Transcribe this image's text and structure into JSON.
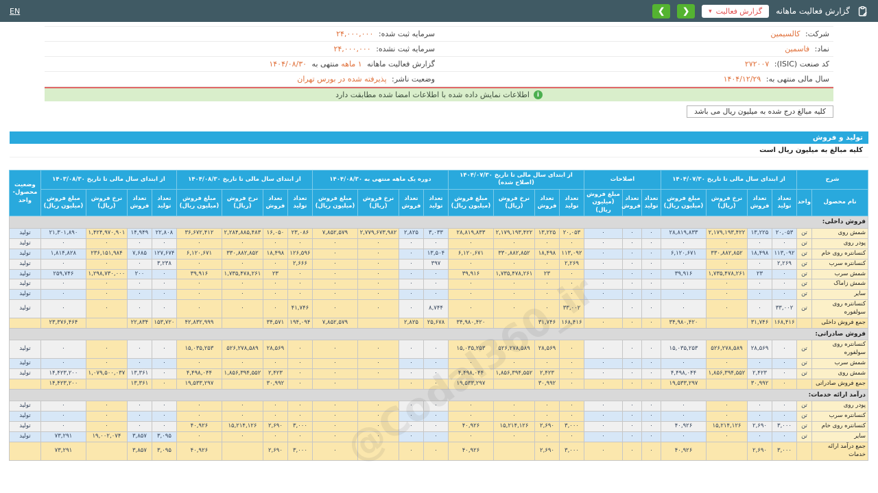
{
  "topbar": {
    "en": "EN",
    "title": "گزارش فعالیت ماهانه",
    "dropdown_label": "گزارش فعالیت",
    "caret": "▾",
    "nav_right": "❯",
    "nav_left": "❮"
  },
  "info": {
    "right": [
      {
        "label": "شرکت:",
        "value": "کالسیمین"
      },
      {
        "label": "نماد:",
        "value": "فاسمین"
      },
      {
        "label": "کد صنعت (ISIC):",
        "value": "۲۷۲۰۰۷"
      },
      {
        "label": "سال مالی منتهی به:",
        "value": "۱۴۰۴/۱۲/۲۹"
      }
    ],
    "left": [
      {
        "label": "سرمایه ثبت شده:",
        "value": "۲۴,۰۰۰,۰۰۰"
      },
      {
        "label": "سرمایه ثبت نشده:",
        "value": "۲۴,۰۰۰,۰۰۰"
      },
      {
        "label": "گزارش فعالیت ماهانه",
        "value": "۱ ماهه",
        "mid": "منتهی به",
        "value2": "۱۴۰۴/۰۸/۳۰"
      },
      {
        "label": "وضعیت ناشر:",
        "value": "پذیرفته شده در بورس تهران"
      }
    ]
  },
  "banner": "اطلاعات نمایش داده شده با اطلاعات امضا شده مطابقت دارد",
  "amount_note": "کلیه مبالغ درج شده به میلیون ریال می باشد",
  "watermark": "@Codal360_ir",
  "colors": {
    "topbar": "#405a64",
    "accent_blue": "#29a9dd",
    "nav_green": "#54b331",
    "value_orange": "#e0703a",
    "cell_yellow": "#fbe7ad",
    "stripe_blue": "#d7e7f7",
    "banner_green": "#d9eecb",
    "red_line": "#e06666"
  },
  "table": {
    "title": "تولید و فروش",
    "note": "کلیه مبالغ به میلیون ریال است",
    "header": {
      "desc": "شرح",
      "product": "نام محصول",
      "unit": "واحد",
      "status": "وضعیت محصول-واحد",
      "sub4": [
        "تعداد تولید",
        "تعداد فروش",
        "نرخ فروش (ریال)",
        "مبلغ فروش (میلیون ریال)"
      ],
      "sub3": [
        "تعداد تولید",
        "تعداد فروش",
        "مبلغ فروش (میلیون ریال)"
      ],
      "groups": [
        {
          "label": "از ابتدای سال مالی تا تاریخ ۱۴۰۴/۰۷/۳۰",
          "cols": 4
        },
        {
          "label": "اصلاحات",
          "cols": 3
        },
        {
          "label": "از ابتدای سال مالی تا تاریخ ۱۴۰۴/۰۷/۳۰ (اصلاح شده)",
          "cols": 4
        },
        {
          "label": "دوره یک ماهه منتهی به ۱۴۰۴/۰۸/۳۰",
          "cols": 4
        },
        {
          "label": "از ابتدای سال مالی تا تاریخ ۱۴۰۴/۰۸/۳۰",
          "cols": 4
        },
        {
          "label": "از ابتدای سال مالی تا تاریخ ۱۴۰۳/۰۸/۳۰",
          "cols": 4
        }
      ]
    },
    "sections": [
      {
        "title": "فروش داخلی:",
        "rows": [
          {
            "name": "شمش روی",
            "unit": "تن",
            "status": "تولید",
            "stripe": "b",
            "prev": [
              "۲۰,۰۵۳",
              "۱۳,۲۲۵",
              "۲,۱۷۹,۱۹۳,۴۲۲",
              "۲۸,۸۱۹,۸۳۳"
            ],
            "adj": [
              "۰",
              "۰",
              "۰"
            ],
            "prev_adj": [
              "۲۰,۰۵۳",
              "۱۳,۲۲۵",
              "۲,۱۷۹,۱۹۳,۴۲۲",
              "۲۸,۸۱۹,۸۳۳"
            ],
            "month": [
              "۳,۰۳۳",
              "۲,۸۲۵",
              "۲,۷۷۹,۶۷۳,۹۸۲",
              "۷,۸۵۲,۵۷۹"
            ],
            "ytd": [
              "۲۳,۰۸۶",
              "۱۶,۰۵۰",
              "۲,۲۸۴,۸۸۵,۴۸۳",
              "۳۶,۶۷۲,۴۱۲"
            ],
            "last": [
              "۲۲,۸۰۸",
              "۱۴,۹۴۹",
              "۱,۴۲۴,۹۷۰,۹۰۱",
              "۲۱,۳۰۱,۸۹۰"
            ]
          },
          {
            "name": "پودر روی",
            "unit": "تن",
            "status": "تولید",
            "stripe": "w",
            "prev": [
              "۰",
              "۰",
              "۰",
              "۰"
            ],
            "adj": [
              "۰",
              "۰",
              "۰"
            ],
            "prev_adj": [
              "۰",
              "۰",
              "۰",
              "۰"
            ],
            "month": [
              "۰",
              "۰",
              "۰",
              "۰"
            ],
            "ytd": [
              "۰",
              "۰",
              "۰",
              "۰"
            ],
            "last": [
              "۰",
              "۰",
              "۰",
              "۰"
            ]
          },
          {
            "name": "کنسانتره روی خام",
            "unit": "تن",
            "status": "تولید",
            "stripe": "b",
            "prev": [
              "۱۱۳,۰۹۲",
              "۱۸,۴۹۸",
              "۳۳۰,۸۸۲,۸۵۲",
              "۶,۱۲۰,۶۷۱"
            ],
            "adj": [
              "۰",
              "۰",
              "۰"
            ],
            "prev_adj": [
              "۱۱۳,۰۹۲",
              "۱۸,۴۹۸",
              "۳۳۰,۸۸۲,۸۵۲",
              "۶,۱۲۰,۶۷۱"
            ],
            "month": [
              "۱۳,۵۰۴",
              "۰",
              "۰",
              "۰"
            ],
            "ytd": [
              "۱۲۶,۵۹۶",
              "۱۸,۴۹۸",
              "۳۳۰,۸۸۲,۸۵۲",
              "۶,۱۲۰,۶۷۱"
            ],
            "last": [
              "۱۲۷,۶۷۴",
              "۷,۶۸۵",
              "۲۳۶,۱۵۱,۹۸۴",
              "۱,۸۱۴,۸۲۸"
            ]
          },
          {
            "name": "کنسانتره سرب",
            "unit": "تن",
            "status": "تولید",
            "stripe": "w",
            "prev": [
              "۲,۲۶۹",
              "۰",
              "۰",
              "۰"
            ],
            "adj": [
              "۰",
              "۰",
              "۰"
            ],
            "prev_adj": [
              "۲,۲۶۹",
              "۰",
              "۰",
              "۰"
            ],
            "month": [
              "۳۹۷",
              "۰",
              "۰",
              "۰"
            ],
            "ytd": [
              "۲,۶۶۶",
              "۰",
              "۰",
              "۰"
            ],
            "last": [
              "۳,۲۳۸",
              "۰",
              "۰",
              "۰"
            ]
          },
          {
            "name": "شمش سرب",
            "unit": "تن",
            "status": "تولید",
            "stripe": "b",
            "prev": [
              "۰",
              "۲۳",
              "۱,۷۳۵,۴۷۸,۲۶۱",
              "۳۹,۹۱۶"
            ],
            "adj": [
              "۰",
              "۰",
              "۰"
            ],
            "prev_adj": [
              "۰",
              "۲۳",
              "۱,۷۳۵,۴۷۸,۲۶۱",
              "۳۹,۹۱۶"
            ],
            "month": [
              "۰",
              "۰",
              "۰",
              "۰"
            ],
            "ytd": [
              "۰",
              "۲۳",
              "۱,۷۳۵,۴۷۸,۲۶۱",
              "۳۹,۹۱۶"
            ],
            "last": [
              "۰",
              "۲۰۰",
              "۱,۲۹۸,۷۳۰,۰۰۰",
              "۲۵۹,۷۴۶"
            ]
          },
          {
            "name": "شمش زاماک",
            "unit": "تن",
            "status": "تولید",
            "stripe": "w",
            "prev": [
              "۰",
              "۰",
              "۰",
              "۰"
            ],
            "adj": [
              "۰",
              "۰",
              "۰"
            ],
            "prev_adj": [
              "۰",
              "۰",
              "۰",
              "۰"
            ],
            "month": [
              "۰",
              "۰",
              "۰",
              "۰"
            ],
            "ytd": [
              "۰",
              "۰",
              "۰",
              "۰"
            ],
            "last": [
              "۰",
              "۰",
              "۰",
              "۰"
            ]
          },
          {
            "name": "سایر",
            "unit": "تن",
            "status": "تولید",
            "stripe": "b",
            "prev": [
              "۰",
              "۰",
              "۰",
              "۰"
            ],
            "adj": [
              "۰",
              "۰",
              "۰"
            ],
            "prev_adj": [
              "۰",
              "۰",
              "۰",
              "۰"
            ],
            "month": [
              "۰",
              "۰",
              "۰",
              "۰"
            ],
            "ytd": [
              "۰",
              "۰",
              "۰",
              "۰"
            ],
            "last": [
              "۰",
              "۰",
              "۰",
              "۰"
            ]
          },
          {
            "name": "کنسانتره روی سولفوره",
            "unit": "تن",
            "status": "تولید",
            "stripe": "w",
            "prev": [
              "۳۳,۰۰۲",
              "۰",
              "۰",
              "۰"
            ],
            "adj": [
              "۰",
              "۰",
              "۰"
            ],
            "prev_adj": [
              "۳۳,۰۰۲",
              "۰",
              "۰",
              "۰"
            ],
            "month": [
              "۸,۷۴۴",
              "۰",
              "۰",
              "۰"
            ],
            "ytd": [
              "۴۱,۷۴۶",
              "۰",
              "۰",
              "۰"
            ],
            "last": [
              "۰",
              "۰",
              "۰",
              "۰"
            ]
          },
          {
            "name": "جمع فروش داخلی",
            "unit": "",
            "status": "",
            "total": true,
            "prev": [
              "۱۶۸,۴۱۶",
              "۳۱,۷۴۶",
              "",
              "۳۴,۹۸۰,۴۲۰"
            ],
            "adj": [
              "۰",
              "۰",
              "۰"
            ],
            "prev_adj": [
              "۱۶۸,۴۱۶",
              "۳۱,۷۴۶",
              "",
              "۳۴,۹۸۰,۴۲۰"
            ],
            "month": [
              "۲۵,۶۷۸",
              "۲,۸۲۵",
              "",
              "۷,۸۵۲,۵۷۹"
            ],
            "ytd": [
              "۱۹۴,۰۹۴",
              "۳۴,۵۷۱",
              "",
              "۴۲,۸۳۲,۹۹۹"
            ],
            "last": [
              "۱۵۳,۷۲۰",
              "۲۲,۸۳۴",
              "",
              "۲۳,۳۷۶,۴۶۴"
            ]
          }
        ]
      },
      {
        "title": "فروش صادراتی:",
        "rows": [
          {
            "name": "کنسانتره روی سولفوره",
            "unit": "تن",
            "status": "تولید",
            "stripe": "w",
            "prev": [
              "۰",
              "۲۸,۵۶۹",
              "۵۲۶,۲۷۸,۵۸۹",
              "۱۵,۰۳۵,۲۵۳"
            ],
            "adj": [
              "۰",
              "۰",
              "۰"
            ],
            "prev_adj": [
              "۰",
              "۲۸,۵۶۹",
              "۵۲۶,۲۷۸,۵۸۹",
              "۱۵,۰۳۵,۲۵۳"
            ],
            "month": [
              "۰",
              "۰",
              "۰",
              "۰"
            ],
            "ytd": [
              "۰",
              "۲۸,۵۶۹",
              "۵۲۶,۲۷۸,۵۸۹",
              "۱۵,۰۳۵,۲۵۳"
            ],
            "last": [
              "۰",
              "۰",
              "۰",
              "۰"
            ]
          },
          {
            "name": "شمش سرب",
            "unit": "تن",
            "status": "تولید",
            "stripe": "b",
            "prev": [
              "۰",
              "۰",
              "۰",
              "۰"
            ],
            "adj": [
              "۰",
              "۰",
              "۰"
            ],
            "prev_adj": [
              "۰",
              "۰",
              "۰",
              "۰"
            ],
            "month": [
              "۰",
              "۰",
              "۰",
              "۰"
            ],
            "ytd": [
              "۰",
              "۰",
              "۰",
              "۰"
            ],
            "last": [
              "۰",
              "۰",
              "۰",
              "۰"
            ]
          },
          {
            "name": "شمش روی",
            "unit": "تن",
            "status": "تولید",
            "stripe": "w",
            "prev": [
              "۰",
              "۲,۴۲۳",
              "۱,۸۵۶,۳۹۴,۵۵۲",
              "۴,۴۹۸,۰۴۴"
            ],
            "adj": [
              "۰",
              "۰",
              "۰"
            ],
            "prev_adj": [
              "۰",
              "۲,۴۲۳",
              "۱,۸۵۶,۳۹۴,۵۵۲",
              "۴,۴۹۸,۰۴۴"
            ],
            "month": [
              "۰",
              "۰",
              "۰",
              "۰"
            ],
            "ytd": [
              "۰",
              "۲,۴۲۳",
              "۱,۸۵۶,۳۹۴,۵۵۲",
              "۴,۴۹۸,۰۴۴"
            ],
            "last": [
              "۰",
              "۱۳,۳۶۱",
              "۱,۰۷۹,۵۰۰,۰۳۷",
              "۱۴,۴۲۳,۲۰۰"
            ]
          },
          {
            "name": "جمع فروش صادراتی",
            "unit": "",
            "status": "",
            "total": true,
            "prev": [
              "۰",
              "۳۰,۹۹۲",
              "",
              "۱۹,۵۳۳,۲۹۷"
            ],
            "adj": [
              "۰",
              "۰",
              "۰"
            ],
            "prev_adj": [
              "۰",
              "۳۰,۹۹۲",
              "",
              "۱۹,۵۳۳,۲۹۷"
            ],
            "month": [
              "۰",
              "۰",
              "",
              "۰"
            ],
            "ytd": [
              "۰",
              "۳۰,۹۹۲",
              "",
              "۱۹,۵۳۳,۲۹۷"
            ],
            "last": [
              "۰",
              "۱۳,۳۶۱",
              "",
              "۱۴,۴۲۳,۲۰۰"
            ]
          }
        ]
      },
      {
        "title": "درآمد ارائه خدمات:",
        "rows": [
          {
            "name": "پودر روی",
            "unit": "تن",
            "status": "تولید",
            "stripe": "w",
            "prev": [
              "۰",
              "۰",
              "۰",
              "۰"
            ],
            "adj": [
              "۰",
              "۰",
              "۰"
            ],
            "prev_adj": [
              "۰",
              "۰",
              "۰",
              "۰"
            ],
            "month": [
              "۰",
              "۰",
              "۰",
              "۰"
            ],
            "ytd": [
              "۰",
              "۰",
              "۰",
              "۰"
            ],
            "last": [
              "۰",
              "۰",
              "۰",
              "۰"
            ]
          },
          {
            "name": "کنسانتره سرب",
            "unit": "تن",
            "status": "تولید",
            "stripe": "b",
            "prev": [
              "۰",
              "۰",
              "۰",
              "۰"
            ],
            "adj": [
              "۰",
              "۰",
              "۰"
            ],
            "prev_adj": [
              "۰",
              "۰",
              "۰",
              "۰"
            ],
            "month": [
              "۰",
              "۰",
              "۰",
              "۰"
            ],
            "ytd": [
              "۰",
              "۰",
              "۰",
              "۰"
            ],
            "last": [
              "۰",
              "۰",
              "۰",
              "۰"
            ]
          },
          {
            "name": "کنسانتره روی خام",
            "unit": "تن",
            "status": "تولید",
            "stripe": "w",
            "prev": [
              "۳,۰۰۰",
              "۲,۶۹۰",
              "۱۵,۲۱۴,۱۲۶",
              "۴۰,۹۲۶"
            ],
            "adj": [
              "۰",
              "۰",
              "۰"
            ],
            "prev_adj": [
              "۳,۰۰۰",
              "۲,۶۹۰",
              "۱۵,۲۱۴,۱۲۶",
              "۴۰,۹۲۶"
            ],
            "month": [
              "۰",
              "۰",
              "۰",
              "۰"
            ],
            "ytd": [
              "۳,۰۰۰",
              "۲,۶۹۰",
              "۱۵,۲۱۴,۱۲۶",
              "۴۰,۹۲۶"
            ],
            "last": [
              "۰",
              "۰",
              "۰",
              "۰"
            ]
          },
          {
            "name": "سایر",
            "unit": "تن",
            "status": "تولید",
            "stripe": "b",
            "prev": [
              "۰",
              "۰",
              "۰",
              "۰"
            ],
            "adj": [
              "۰",
              "۰",
              "۰"
            ],
            "prev_adj": [
              "۰",
              "۰",
              "۰",
              "۰"
            ],
            "month": [
              "۰",
              "۰",
              "۰",
              "۰"
            ],
            "ytd": [
              "۰",
              "۰",
              "۰",
              "۰"
            ],
            "last": [
              "۳,۰۹۵",
              "۳,۸۵۷",
              "۱۹,۰۰۲,۰۷۴",
              "۷۳,۲۹۱"
            ]
          },
          {
            "name": "جمع درآمد ارائه خدمات",
            "unit": "",
            "status": "",
            "total": true,
            "prev": [
              "۳,۰۰۰",
              "۲,۶۹۰",
              "",
              "۴۰,۹۲۶"
            ],
            "adj": [
              "۰",
              "۰",
              "۰"
            ],
            "prev_adj": [
              "۳,۰۰۰",
              "۲,۶۹۰",
              "",
              "۴۰,۹۲۶"
            ],
            "month": [
              "۰",
              "۰",
              "",
              "۰"
            ],
            "ytd": [
              "۳,۰۰۰",
              "۲,۶۹۰",
              "",
              "۴۰,۹۲۶"
            ],
            "last": [
              "۳,۰۹۵",
              "۳,۸۵۷",
              "",
              "۷۳,۲۹۱"
            ]
          }
        ]
      }
    ]
  }
}
